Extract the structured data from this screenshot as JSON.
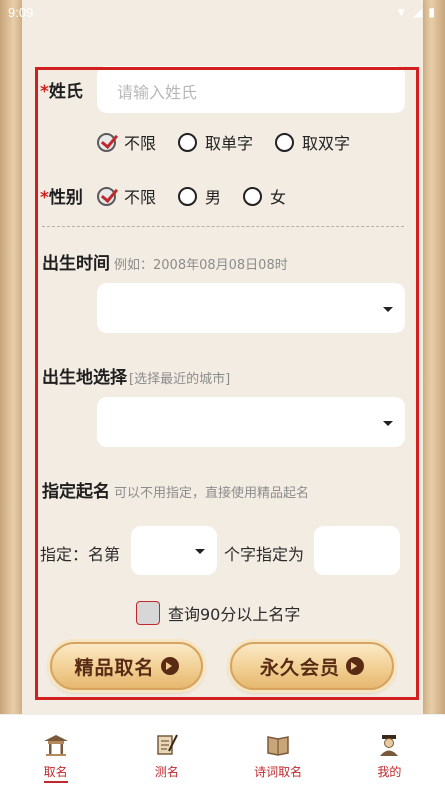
{
  "status_bar": {
    "time": "9:09"
  },
  "form": {
    "surname": {
      "label": "姓氏",
      "required_mark": "*",
      "placeholder": "请输入姓氏"
    },
    "name_length": {
      "options": [
        "不限",
        "取单字",
        "取双字"
      ],
      "selected": "不限"
    },
    "gender": {
      "label": "性别",
      "required_mark": "*",
      "options": [
        "不限",
        "男",
        "女"
      ],
      "selected": "不限"
    },
    "birth_time": {
      "label": "出生时间",
      "hint": "例如：2008年08月08日08时",
      "value": ""
    },
    "birth_place": {
      "label": "出生地选择",
      "hint": "[选择最近的城市]",
      "value": ""
    },
    "specify": {
      "label": "指定起名",
      "hint": "可以不用指定，直接使用精品起名",
      "prefix": "指定：名第",
      "suffix": "个字指定为",
      "position_value": "",
      "char_value": ""
    },
    "high_score": {
      "label": "查询90分以上名字",
      "checked": false
    }
  },
  "buttons": {
    "premium": "精品取名",
    "vip": "永久会员"
  },
  "nav": {
    "items": [
      {
        "label": "取名",
        "icon": "pavilion-icon",
        "active": true
      },
      {
        "label": "测名",
        "icon": "scroll-pen-icon",
        "active": false
      },
      {
        "label": "诗词取名",
        "icon": "book-icon",
        "active": false
      },
      {
        "label": "我的",
        "icon": "scholar-icon",
        "active": false
      }
    ]
  },
  "colors": {
    "accent": "#c0282d",
    "frame": "#d21f1f",
    "button_text": "#5a2b14",
    "button_gold": "#f1cf92"
  }
}
